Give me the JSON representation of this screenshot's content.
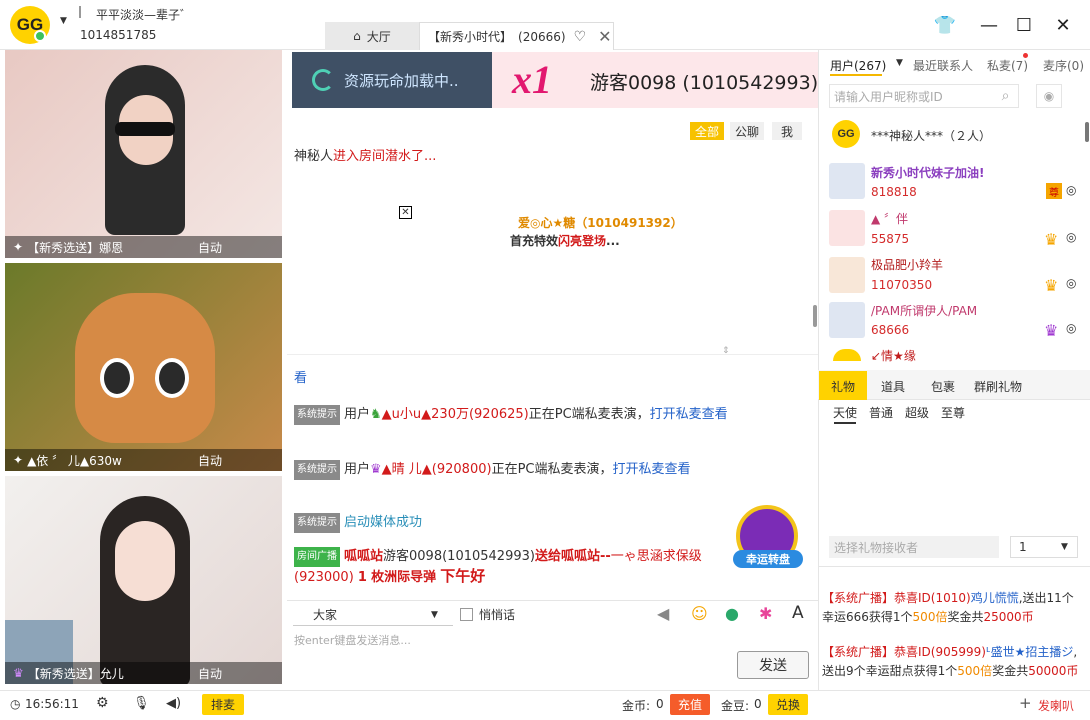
{
  "header": {
    "logo_text": "GG",
    "nickname": "平平淡淡—辈子゛",
    "user_id": "1014851785",
    "tabs": [
      {
        "label": "大厅"
      },
      {
        "label": "【新秀小时代】",
        "count": "(20666)"
      }
    ]
  },
  "videos": [
    {
      "caption": "【新秀选送】娜恩",
      "mode": "自动",
      "colors": [
        "#e8c9c3",
        "#f4e7e4"
      ]
    },
    {
      "caption": "▲依 〞 儿▲630w",
      "mode": "自动",
      "colors": [
        "#6b7a2a",
        "#c88a4a"
      ]
    },
    {
      "caption": "【新秀选送】允儿",
      "mode": "自动",
      "colors": [
        "#f2f0ee",
        "#e4d7d4"
      ]
    }
  ],
  "banner": {
    "resource_text": "资源玩命加载中..",
    "multiplier": "x1",
    "guest": "游客0098 (1010542993)"
  },
  "chat_filters": [
    "全部",
    "公聊",
    "我"
  ],
  "chat": {
    "line1_name": "神秘人",
    "line1_text": "进入房间潜水了...",
    "effect_name": "爱◎心★糖",
    "effect_id": "（1010491392）",
    "effect_pre": "首充特效",
    "effect_hl": "闪亮登场",
    "effect_post": "...",
    "line_kan": "看",
    "sys_label": "系统提示",
    "bcast_label": "房间广播",
    "msg2_pre": "用户",
    "msg2_user": "▲u小u▲230万(920625)",
    "msg2_mid": "正在PC端私麦表演，",
    "msg2_link": "打开私麦查看",
    "msg3_pre": "用户",
    "msg3_user": "▲晴 儿▲(920800)",
    "msg3_mid": "正在PC端私麦表演，",
    "msg3_link": "打开私麦查看",
    "msg4": "启动媒体成功",
    "msg5_site": "呱呱站",
    "msg5_guest": "游客0098(1010542993)",
    "msg5_send": "送给呱呱站--",
    "msg5_target": "一ゃ思涵求保级(923000)",
    "msg5_n": "1",
    "msg5_gift": "枚洲际导弹",
    "msg5_tail": "下午好"
  },
  "input": {
    "target": "大家",
    "whisper": "悄悄话",
    "placeholder": "按enter键盘发送消息...",
    "send": "发送"
  },
  "lucky_wheel": "幸运转盘",
  "right": {
    "tabs": [
      "用户(267)",
      "最近联系人",
      "私麦(7)",
      "麦序(0)"
    ],
    "search_placeholder": "请输入用户昵称或ID",
    "mystery": "***神秘人***（２人）",
    "users": [
      {
        "name": "新秀小时代妹子加油!",
        "num": "818818",
        "badge": "尊"
      },
      {
        "name": "▲ 〞伴",
        "num": "55875",
        "badge": "冠"
      },
      {
        "name": "极品肥小羚羊",
        "num": "11070350",
        "badge": "冠"
      },
      {
        "name": "/PAM所谓伊人/PAM",
        "num": "68666",
        "badge": "冠"
      },
      {
        "name": "↙情★缘",
        "num": "",
        "badge": ""
      }
    ],
    "gift_tabs": [
      "礼物",
      "道具",
      "包裹",
      "群刷礼物"
    ],
    "gift_sub": [
      "天使",
      "普通",
      "超级",
      "至尊"
    ],
    "recv_placeholder": "选择礼物接收者",
    "qty": "1",
    "msgs": [
      {
        "tag": "【系统广播】",
        "pre": "恭喜ID(1010)",
        "user": "鸡儿慌慌",
        "t1": ",送出11个幸运666获得1个",
        "mul": "500倍",
        "t2": "奖金共",
        "amt": "25000币"
      },
      {
        "tag": "【系统广播】",
        "pre": "恭喜ID(905999)",
        "user": "ᒻ盛世★招主播ジ",
        "t1": ",送出9个幸运甜点获得1个",
        "mul": "500倍",
        "t2": "奖金共",
        "amt": "50000币"
      }
    ],
    "horn": "发喇叭"
  },
  "bottom": {
    "time": "16:56:11",
    "queue": "排麦",
    "gold_label": "金币:",
    "gold": "0",
    "recharge": "充值",
    "bean_label": "金豆:",
    "bean": "0",
    "exchange": "兑换"
  },
  "colors": {
    "accent": "#ffd200",
    "red": "#d21a1a",
    "blue": "#2462c9",
    "banner_bg": "#3f5065"
  }
}
